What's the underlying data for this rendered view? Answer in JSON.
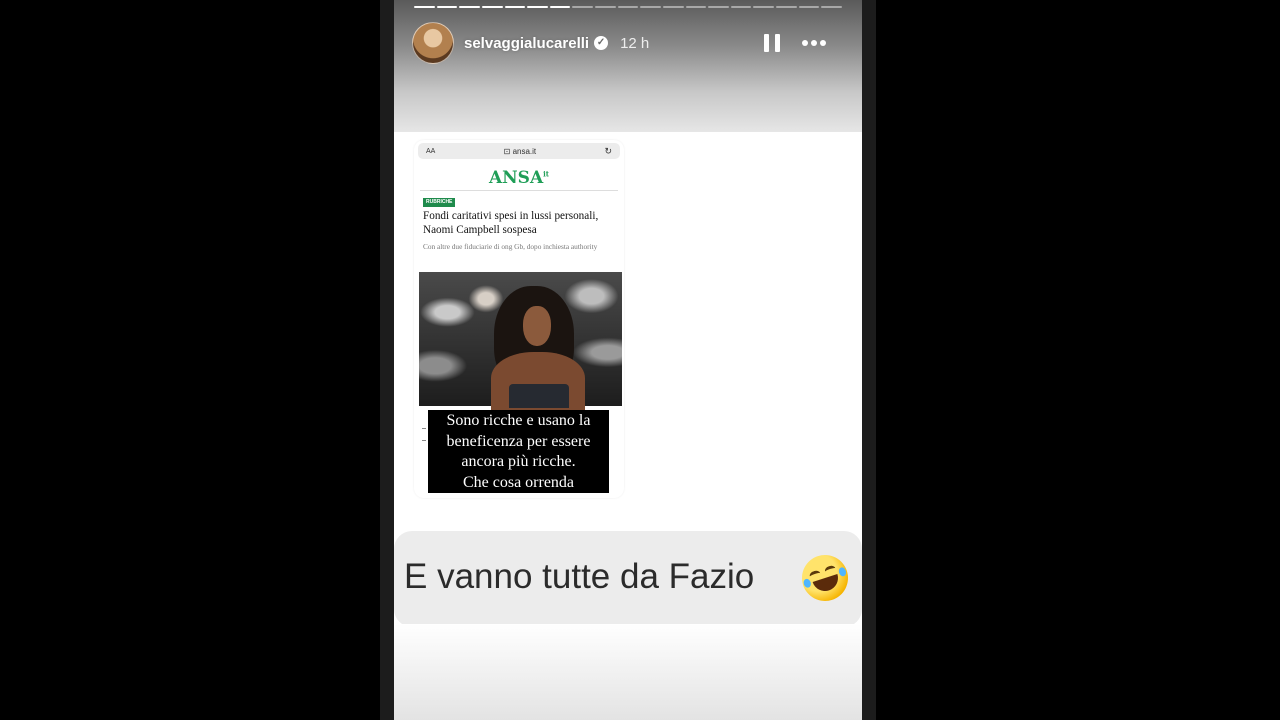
{
  "story": {
    "segments_total": 19,
    "segments_done": 7,
    "username": "selvaggialucarelli",
    "verified": true,
    "time_ago": "12 h"
  },
  "embedded_page": {
    "text_size_control": "AA",
    "url": "ansa.it",
    "logo": "ANSA",
    "logo_suffix": "it",
    "section": "RUBRICHE",
    "headline": "Fondi caritativi spesi in lussi personali, Naomi Campbell sospesa",
    "subheadline": "Con altre due fiduciarie di ong Gb, dopo inchiesta authority",
    "caption_lines": [
      "Sono ricche e usano la",
      "beneficenza per essere",
      "ancora più ricche.",
      "Che cosa orrenda"
    ]
  },
  "comment": {
    "text": "E vanno tutte da Fazio",
    "emoji": "rolling-on-the-floor-laughing"
  },
  "icons": {
    "verified": "verified-badge-icon",
    "pause": "pause-icon",
    "more": "more-options-icon",
    "reload": "reload-icon",
    "lock": "lock-icon"
  }
}
